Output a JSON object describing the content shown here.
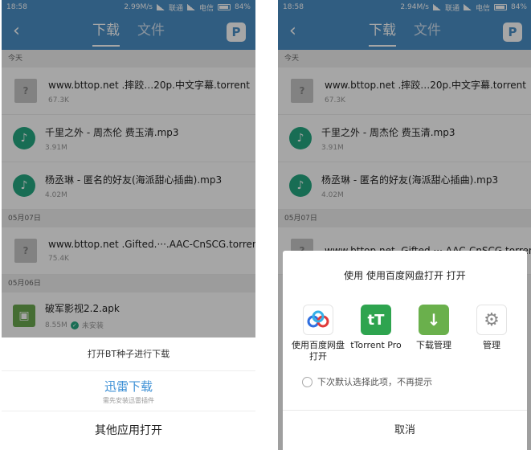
{
  "left": {
    "status": {
      "time": "18:58",
      "speed": "2.99M/s",
      "carrier1": "联通",
      "carrier2": "电信",
      "battery": "84%"
    },
    "header": {
      "back_icon": "chevron-left-icon",
      "tab_download": "下载",
      "tab_files": "文件",
      "logo": "P"
    },
    "sections": [
      {
        "label": "今天",
        "items": [
          {
            "name": "www.bttop.net .摔跤…20p.中文字幕.torrent",
            "size": "67.3K",
            "icon": "unknown-file-icon"
          },
          {
            "name": "千里之外 - 周杰伦 费玉清.mp3",
            "size": "3.91M",
            "icon": "music-icon"
          },
          {
            "name": "杨丞琳 - 匿名的好友(海派甜心插曲).mp3",
            "size": "4.02M",
            "icon": "music-icon"
          }
        ]
      },
      {
        "label": "05月07日",
        "items": [
          {
            "name": "www.bttop.net .Gifted.···.AAC-CnSCG.torrent",
            "size": "75.4K",
            "icon": "unknown-file-icon"
          }
        ]
      },
      {
        "label": "05月06日",
        "items": [
          {
            "name": "破军影视2.2.apk",
            "size": "8.55M",
            "status": "未安装",
            "icon": "android-icon"
          }
        ]
      }
    ],
    "sheet": {
      "head": "打开BT种子进行下载",
      "option1": "迅雷下载",
      "option1_sub": "需先安装迅雷插件",
      "option2": "其他应用打开"
    }
  },
  "right": {
    "status": {
      "time": "18:58",
      "speed": "2.94M/s",
      "carrier1": "联通",
      "carrier2": "电信",
      "battery": "84%"
    },
    "header": {
      "tab_download": "下载",
      "tab_files": "文件",
      "logo": "P"
    },
    "sections": [
      {
        "label": "今天",
        "items": [
          {
            "name": "www.bttop.net .摔跤…20p.中文字幕.torrent",
            "size": "67.3K"
          },
          {
            "name": "千里之外 - 周杰伦 费玉清.mp3",
            "size": "3.91M"
          },
          {
            "name": "杨丞琳 - 匿名的好友(海派甜心插曲).mp3",
            "size": "4.02M"
          }
        ]
      },
      {
        "label": "05月07日",
        "items": [
          {
            "name": "www.bttop.net .Gifted.···.AAC-CnSCG.torrent",
            "size": ""
          }
        ]
      }
    ],
    "dialog": {
      "title": "使用 使用百度网盘打开 打开",
      "apps": [
        {
          "label": "使用百度网盘打开",
          "icon": "baidu-netdisk-icon"
        },
        {
          "label": "tTorrent Pro",
          "icon": "ttorrent-icon",
          "glyph": "tT"
        },
        {
          "label": "下载管理",
          "icon": "download-manager-icon",
          "glyph": "↓"
        },
        {
          "label": "管理",
          "icon": "gear-icon",
          "glyph": "⚙"
        }
      ],
      "remember": "下次默认选择此项，不再提示",
      "cancel": "取消"
    }
  }
}
